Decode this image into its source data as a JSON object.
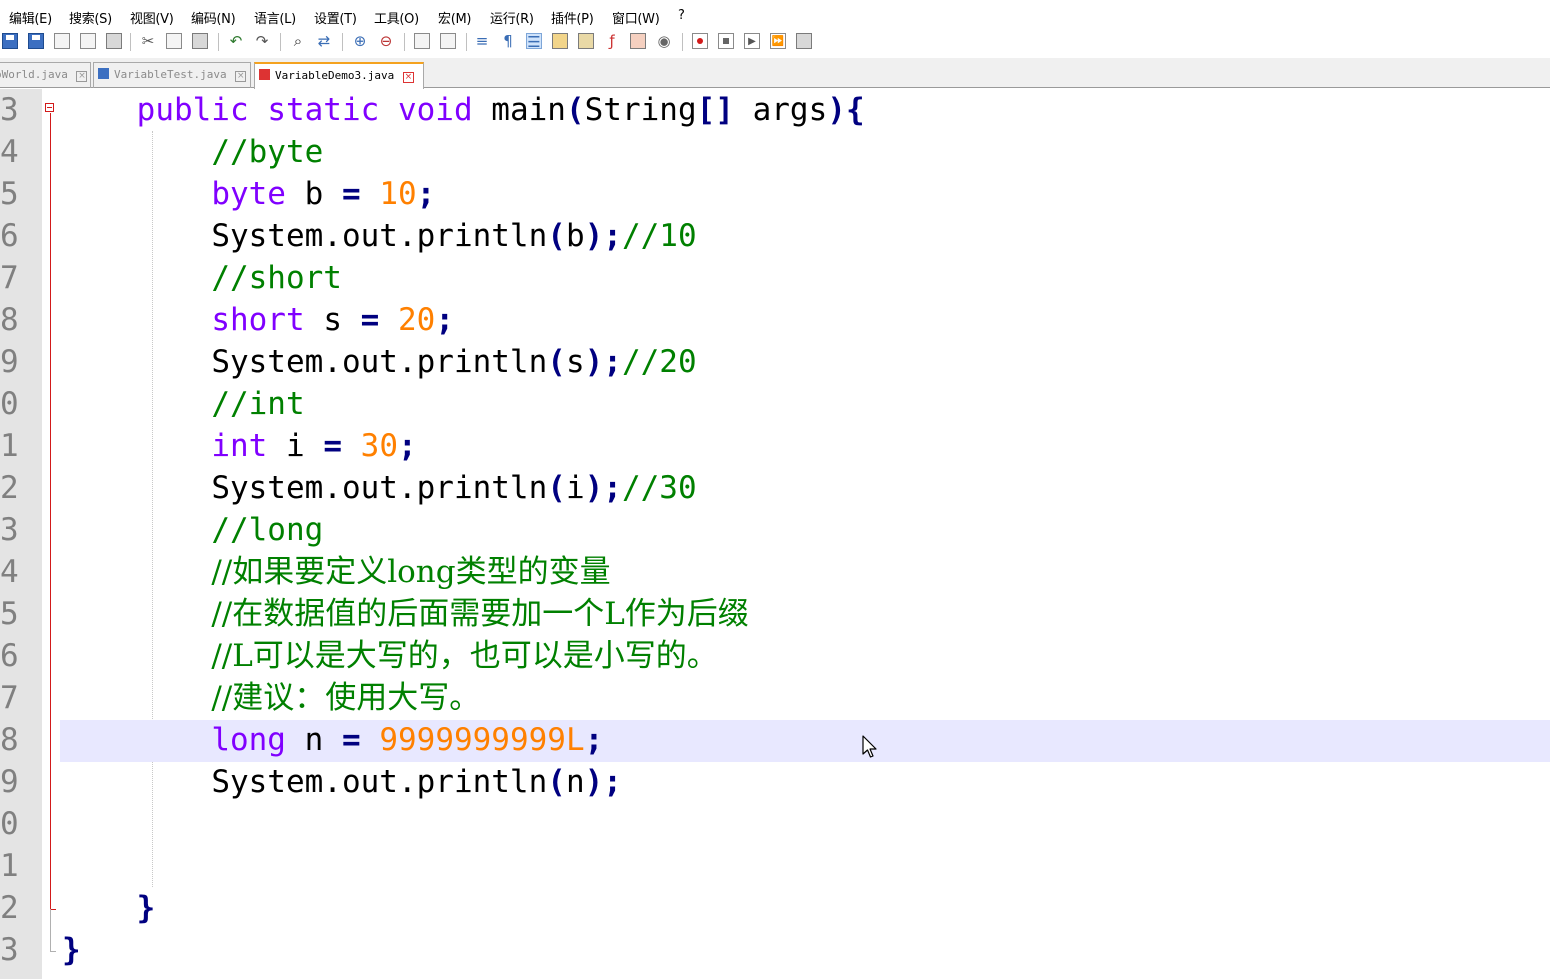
{
  "menu": [
    "编辑(E)",
    "搜索(S)",
    "视图(V)",
    "编码(N)",
    "语言(L)",
    "设置(T)",
    "工具(O)",
    "宏(M)",
    "运行(R)",
    "插件(P)",
    "窗口(W)",
    "?"
  ],
  "tabs": [
    {
      "label": "oWorld.java",
      "active": false
    },
    {
      "label": "VariableTest.java",
      "active": false
    },
    {
      "label": "VariableDemo3.java",
      "active": true
    }
  ],
  "line_numbers": [
    "3",
    "4",
    "5",
    "6",
    "7",
    "8",
    "9",
    "0",
    "1",
    "2",
    "3",
    "4",
    "5",
    "6",
    "7",
    "8",
    "9",
    "0",
    "1",
    "2",
    "3"
  ],
  "code": {
    "l3": {
      "kw1": "public",
      "kw2": "static",
      "kw3": "void",
      "name": "main",
      "p1": "(",
      "type": "String",
      "br": "[]",
      "arg": "args",
      "p2": ")",
      "brace": "{"
    },
    "l4": "//byte",
    "l5": {
      "kw": "byte",
      "var": "b",
      "eq": "=",
      "val": "10",
      "semi": ";"
    },
    "l6": {
      "call": "System.out.println",
      "p1": "(",
      "arg": "b",
      "p2": ")",
      "semi": ";",
      "cmt": "//10"
    },
    "l7": "//short",
    "l8": {
      "kw": "short",
      "var": "s",
      "eq": "=",
      "val": "20",
      "semi": ";"
    },
    "l9": {
      "call": "System.out.println",
      "p1": "(",
      "arg": "s",
      "p2": ")",
      "semi": ";",
      "cmt": "//20"
    },
    "l10": "//int",
    "l11": {
      "kw": "int",
      "var": "i",
      "eq": "=",
      "val": "30",
      "semi": ";"
    },
    "l12": {
      "call": "System.out.println",
      "p1": "(",
      "arg": "i",
      "p2": ")",
      "semi": ";",
      "cmt": "//30"
    },
    "l13": "//long",
    "l14": "//如果要定义long类型的变量",
    "l15": "//在数据值的后面需要加一个L作为后缀",
    "l16": "//L可以是大写的，也可以是小写的。",
    "l17": "//建议：使用大写。",
    "l18": {
      "kw": "long",
      "var": "n",
      "eq": "=",
      "val": "9999999999L",
      "semi": ";"
    },
    "l19": {
      "call": "System.out.println",
      "p1": "(",
      "arg": "n",
      "p2": ")",
      "semi": ";"
    },
    "l22": "}",
    "l23": "}"
  }
}
